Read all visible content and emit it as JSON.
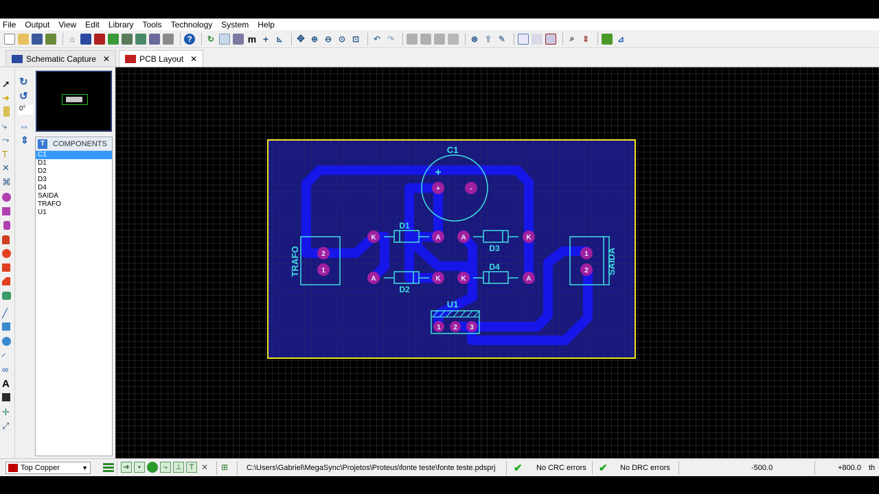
{
  "menu": [
    "File",
    "Output",
    "View",
    "Edit",
    "Library",
    "Tools",
    "Technology",
    "System",
    "Help"
  ],
  "tabs": [
    {
      "label": "Schematic Capture",
      "icon": "ISIS"
    },
    {
      "label": "PCB Layout",
      "icon": "ARES"
    }
  ],
  "rotation": "0°",
  "components": {
    "header": "COMPONENTS",
    "items": [
      "C1",
      "D1",
      "D2",
      "D3",
      "D4",
      "SAIDA",
      "TRAFO",
      "U1"
    ],
    "selected": "C1"
  },
  "pcb": {
    "labels": {
      "c1": "C1",
      "d1": "D1",
      "d2": "D2",
      "d3": "D3",
      "d4": "D4",
      "u1": "U1",
      "trafo": "TRAFO",
      "saida": "SAIDA"
    },
    "pads": {
      "k": "K",
      "a": "A",
      "p1": "1",
      "p2": "2",
      "p3": "3",
      "plus": "+",
      "minus": "-"
    },
    "colors": {
      "board_fill": "#1a1a8a",
      "board_outline": "#f0e020",
      "trace": "#1414e6",
      "pad": "#a020a0",
      "silk": "#40e0e0",
      "grid": "#3a3a3a"
    }
  },
  "status": {
    "layer": "Top Copper",
    "project_path": "C:\\Users\\Gabriel\\MegaSync\\Projetos\\Proteus\\fonte teste\\fonte teste.pdsprj",
    "crc": "No CRC errors",
    "drc": "No DRC errors",
    "coord_x": "-500.0",
    "coord_y": "+800.0",
    "units": "th"
  }
}
